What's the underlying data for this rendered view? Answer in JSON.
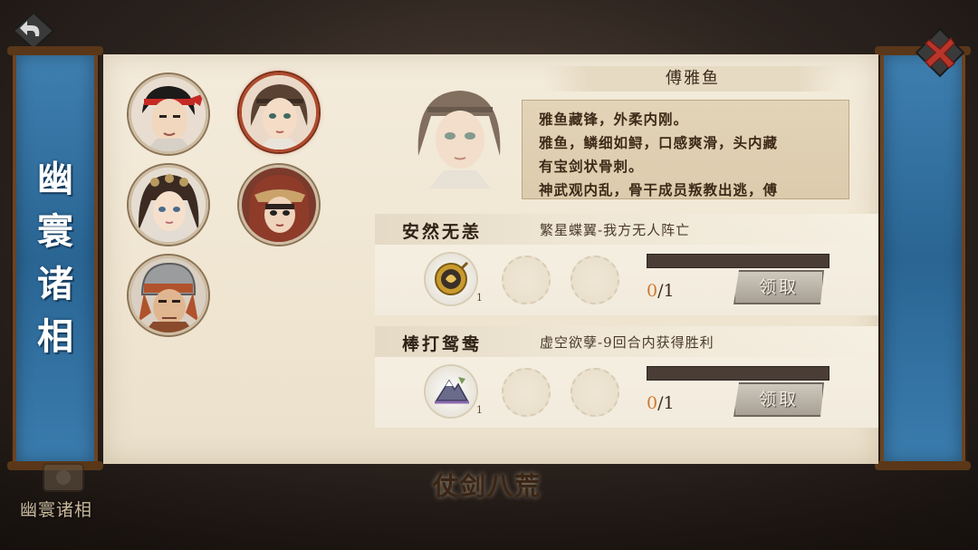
{
  "side_title": [
    "幽",
    "寰",
    "诸",
    "相"
  ],
  "bottom_label": "幽寰诸相",
  "game_logo": "仗剑八荒",
  "characters": [
    {
      "name": "red-headband-hero",
      "selected": false
    },
    {
      "name": "fu-yayu",
      "selected": true
    },
    {
      "name": "braided-lady",
      "selected": false
    },
    {
      "name": "hooded-warrior",
      "selected": false
    },
    {
      "name": "helmeted-general",
      "selected": false
    }
  ],
  "profile": {
    "name": "傅雅鱼",
    "bio": [
      "雅鱼藏锋，外柔内刚。",
      "雅鱼，鳞细如鲟，口感爽滑，头内藏",
      "有宝剑状骨刺。",
      "神武观内乱，骨干成员叛教出逃，傅"
    ]
  },
  "tasks": [
    {
      "title": "安然无恙",
      "description": "繁星蝶翼-我方无人阵亡",
      "reward_icon": "gold-medallion-icon",
      "reward_count": "1",
      "progress_current": "0",
      "progress_total": "/1",
      "progress_fraction": 0,
      "claim_label": "领取"
    },
    {
      "title": "棒打鸳鸯",
      "description": "虚空欲孽-9回合内获得胜利",
      "reward_icon": "mountain-map-icon",
      "reward_count": "1",
      "progress_current": "0",
      "progress_total": "/1",
      "progress_fraction": 0,
      "claim_label": "领取"
    }
  ],
  "colors": {
    "panel_blue": "#2a6593",
    "parchment": "#efe5d1",
    "progress_track": "#4a3d36",
    "claim_button": "#b8b0a4",
    "accent_orange": "#d0782e"
  }
}
